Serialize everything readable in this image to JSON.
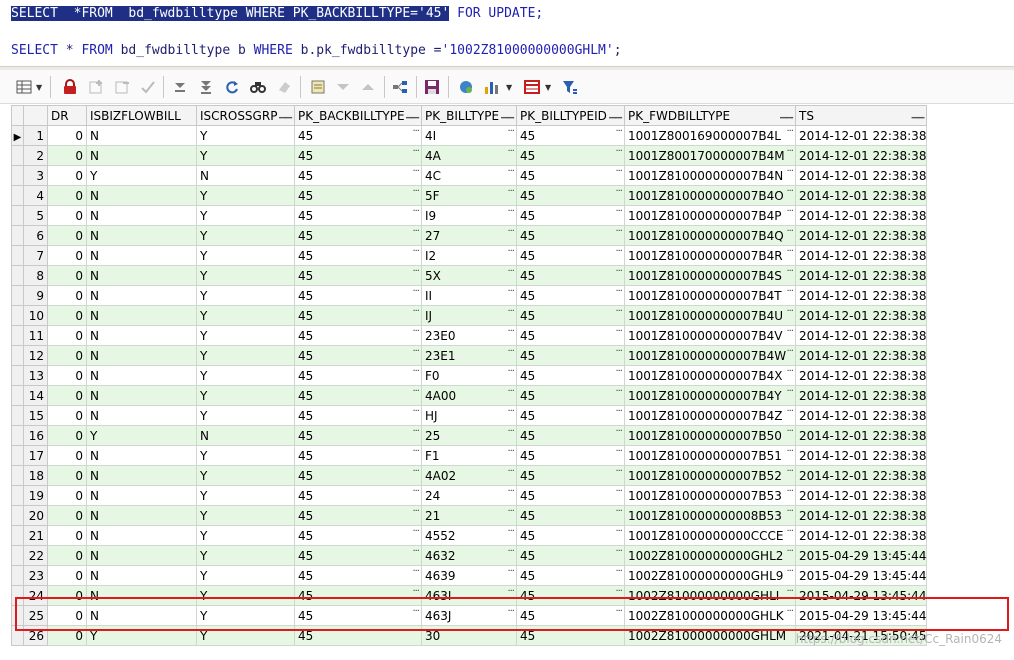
{
  "editor": {
    "line1": {
      "selected": "SELECT  *FROM  bd_fwdbilltype WHERE PK_BACKBILLTYPE='45'",
      "rest": " FOR UPDATE;"
    },
    "line2": {
      "kw1": "SELECT",
      "t1": " * ",
      "kw2": "FROM",
      "t2": " bd_fwdbilltype b ",
      "kw3": "WHERE",
      "t3": " b.pk_fwdbilltype =",
      "str": "'1002Z81000000000GHLM'",
      "t4": ";"
    }
  },
  "toolbar": {
    "icons": [
      "grid-menu-icon",
      "lock-icon",
      "insert-icon",
      "delete-icon",
      "post-icon",
      "fetch-next-icon",
      "fetch-last-icon",
      "refresh-icon",
      "find-icon",
      "clear-icon",
      "filter-icon",
      "move-down-icon",
      "move-up-icon",
      "export-tree-icon",
      "save-icon",
      "query-icon",
      "chart-icon",
      "table-icon",
      "filter-funnel-icon"
    ]
  },
  "grid": {
    "columns": [
      "DR",
      "ISBIZFLOWBILL",
      "ISCROSSGRP",
      "PK_BACKBILLTYPE",
      "PK_BILLTYPE",
      "PK_BILLTYPEID",
      "PK_FWDBILLTYPE",
      "TS"
    ],
    "rows": [
      [
        "1",
        "0",
        "N",
        "Y",
        "45",
        "4I",
        "45",
        "1001Z800169000007B4L",
        "2014-12-01 22:38:38"
      ],
      [
        "2",
        "0",
        "N",
        "Y",
        "45",
        "4A",
        "45",
        "1001Z800170000007B4M",
        "2014-12-01 22:38:38"
      ],
      [
        "3",
        "0",
        "Y",
        "N",
        "45",
        "4C",
        "45",
        "1001Z810000000007B4N",
        "2014-12-01 22:38:38"
      ],
      [
        "4",
        "0",
        "N",
        "Y",
        "45",
        "5F",
        "45",
        "1001Z810000000007B4O",
        "2014-12-01 22:38:38"
      ],
      [
        "5",
        "0",
        "N",
        "Y",
        "45",
        "I9",
        "45",
        "1001Z810000000007B4P",
        "2014-12-01 22:38:38"
      ],
      [
        "6",
        "0",
        "N",
        "Y",
        "45",
        "27",
        "45",
        "1001Z810000000007B4Q",
        "2014-12-01 22:38:38"
      ],
      [
        "7",
        "0",
        "N",
        "Y",
        "45",
        "I2",
        "45",
        "1001Z810000000007B4R",
        "2014-12-01 22:38:38"
      ],
      [
        "8",
        "0",
        "N",
        "Y",
        "45",
        "5X",
        "45",
        "1001Z810000000007B4S",
        "2014-12-01 22:38:38"
      ],
      [
        "9",
        "0",
        "N",
        "Y",
        "45",
        "II",
        "45",
        "1001Z810000000007B4T",
        "2014-12-01 22:38:38"
      ],
      [
        "10",
        "0",
        "N",
        "Y",
        "45",
        "IJ",
        "45",
        "1001Z810000000007B4U",
        "2014-12-01 22:38:38"
      ],
      [
        "11",
        "0",
        "N",
        "Y",
        "45",
        "23E0",
        "45",
        "1001Z810000000007B4V",
        "2014-12-01 22:38:38"
      ],
      [
        "12",
        "0",
        "N",
        "Y",
        "45",
        "23E1",
        "45",
        "1001Z810000000007B4W",
        "2014-12-01 22:38:38"
      ],
      [
        "13",
        "0",
        "N",
        "Y",
        "45",
        "F0",
        "45",
        "1001Z810000000007B4X",
        "2014-12-01 22:38:38"
      ],
      [
        "14",
        "0",
        "N",
        "Y",
        "45",
        "4A00",
        "45",
        "1001Z810000000007B4Y",
        "2014-12-01 22:38:38"
      ],
      [
        "15",
        "0",
        "N",
        "Y",
        "45",
        "HJ",
        "45",
        "1001Z810000000007B4Z",
        "2014-12-01 22:38:38"
      ],
      [
        "16",
        "0",
        "Y",
        "N",
        "45",
        "25",
        "45",
        "1001Z810000000007B50",
        "2014-12-01 22:38:38"
      ],
      [
        "17",
        "0",
        "N",
        "Y",
        "45",
        "F1",
        "45",
        "1001Z810000000007B51",
        "2014-12-01 22:38:38"
      ],
      [
        "18",
        "0",
        "N",
        "Y",
        "45",
        "4A02",
        "45",
        "1001Z810000000007B52",
        "2014-12-01 22:38:38"
      ],
      [
        "19",
        "0",
        "N",
        "Y",
        "45",
        "24",
        "45",
        "1001Z810000000007B53",
        "2014-12-01 22:38:38"
      ],
      [
        "20",
        "0",
        "N",
        "Y",
        "45",
        "21",
        "45",
        "1001Z810000000008B53",
        "2014-12-01 22:38:38"
      ],
      [
        "21",
        "0",
        "N",
        "Y",
        "45",
        "4552",
        "45",
        "1001Z81000000000CCCE",
        "2014-12-01 22:38:38"
      ],
      [
        "22",
        "0",
        "N",
        "Y",
        "45",
        "4632",
        "45",
        "1002Z81000000000GHL2",
        "2015-04-29 13:45:44"
      ],
      [
        "23",
        "0",
        "N",
        "Y",
        "45",
        "4639",
        "45",
        "1002Z81000000000GHL9",
        "2015-04-29 13:45:44"
      ],
      [
        "24",
        "0",
        "N",
        "Y",
        "45",
        "463I",
        "45",
        "1002Z81000000000GHLI",
        "2015-04-29 13:45:44"
      ],
      [
        "25",
        "0",
        "N",
        "Y",
        "45",
        "463J",
        "45",
        "1002Z81000000000GHLK",
        "2015-04-29 13:45:44"
      ],
      [
        "26",
        "0",
        "Y",
        "Y",
        "45",
        "30",
        "45",
        "1002Z81000000000GHLM",
        "2021-04-21 15:50:45"
      ]
    ]
  },
  "watermark": "https://blog.csdn.net/Cc_Rain0624"
}
